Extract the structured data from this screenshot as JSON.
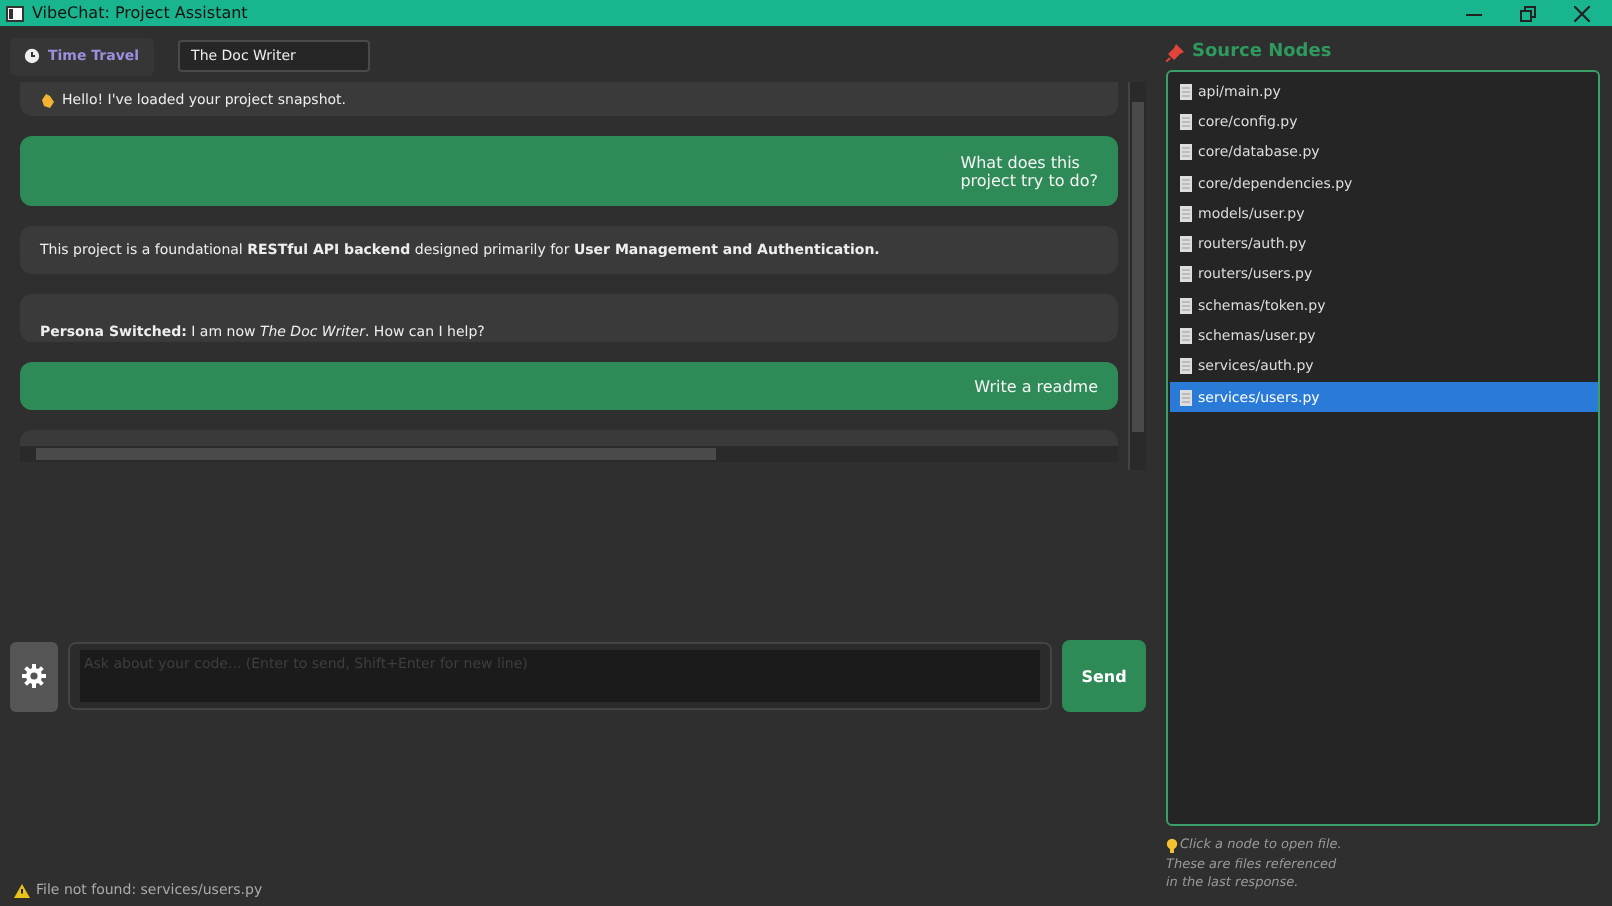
{
  "window": {
    "title": "VibeChat: Project Assistant"
  },
  "toolbar": {
    "time_travel": "Time Travel",
    "persona": "The Doc Writer"
  },
  "messages": [
    {
      "kind": "assistant",
      "text": "Hello! I've loaded your project snapshot."
    },
    {
      "kind": "user",
      "text": "What does this\nproject try to do?"
    },
    {
      "kind": "assistant",
      "text": "This project is a foundational **RESTful API backend** designed primarily for **User Management and Authentication.**"
    },
    {
      "kind": "clipped",
      "text": "**Persona Switched:** I am now *The Doc Writer*. How can I help?"
    },
    {
      "kind": "user",
      "text": "Write a readme"
    }
  ],
  "composer": {
    "placeholder": "Ask about your code... (Enter to send, Shift+Enter for new line)",
    "send": "Send"
  },
  "status_bar": "File not found: services/users.py",
  "source_nodes": {
    "title": "Source Nodes",
    "items": [
      {
        "label": "api/main.py",
        "selected": false
      },
      {
        "label": "core/config.py",
        "selected": false
      },
      {
        "label": "core/database.py",
        "selected": false
      },
      {
        "label": "core/dependencies.py",
        "selected": false
      },
      {
        "label": "models/user.py",
        "selected": false
      },
      {
        "label": "routers/auth.py",
        "selected": false
      },
      {
        "label": "routers/users.py",
        "selected": false
      },
      {
        "label": "schemas/token.py",
        "selected": false
      },
      {
        "label": "schemas/user.py",
        "selected": false
      },
      {
        "label": "services/auth.py",
        "selected": false
      },
      {
        "label": "services/users.py",
        "selected": true
      }
    ],
    "hint": [
      "Click a node to open file.",
      "These are files referenced",
      "in the last response."
    ]
  }
}
